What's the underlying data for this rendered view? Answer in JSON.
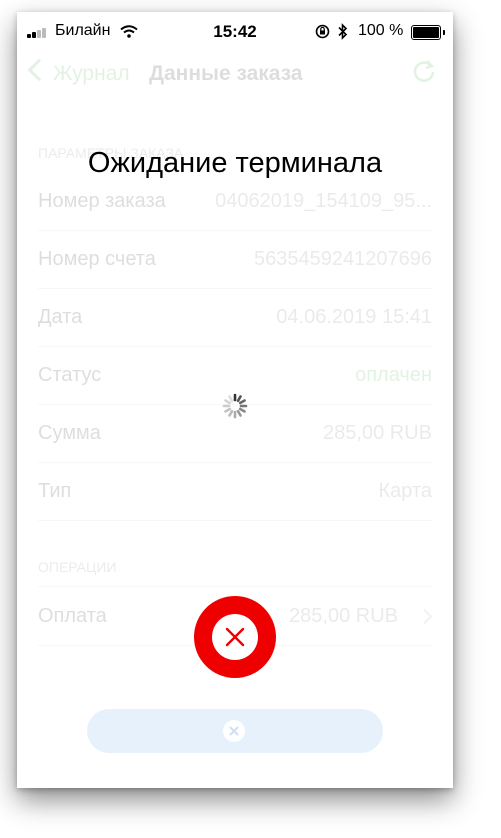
{
  "status_bar": {
    "carrier": "Билайн",
    "time": "15:42",
    "battery": "100 %"
  },
  "nav": {
    "back_label": "Журнал",
    "title": "Данные заказа"
  },
  "sections": {
    "params": "ПАРАМЕТРЫ ЗАКАЗА",
    "operations": "ОПЕРАЦИИ"
  },
  "order": {
    "number_label": "Номер заказа",
    "number_value": "04062019_154109_95...",
    "account_label": "Номер счета",
    "account_value": "5635459241207696",
    "date_label": "Дата",
    "date_value": "04.06.2019 15:41",
    "status_label": "Статус",
    "status_value": "оплачен",
    "sum_label": "Сумма",
    "sum_value": "285,00 RUB",
    "type_label": "Тип",
    "type_value": "Карта"
  },
  "operation": {
    "label": "Оплата",
    "value": "285,00 RUB"
  },
  "overlay": {
    "heading": "Ожидание терминала"
  },
  "colors": {
    "accent_green": "#2ca02c",
    "cancel_red": "#ee0000",
    "bottom_button_bg": "#e7f1fc"
  }
}
